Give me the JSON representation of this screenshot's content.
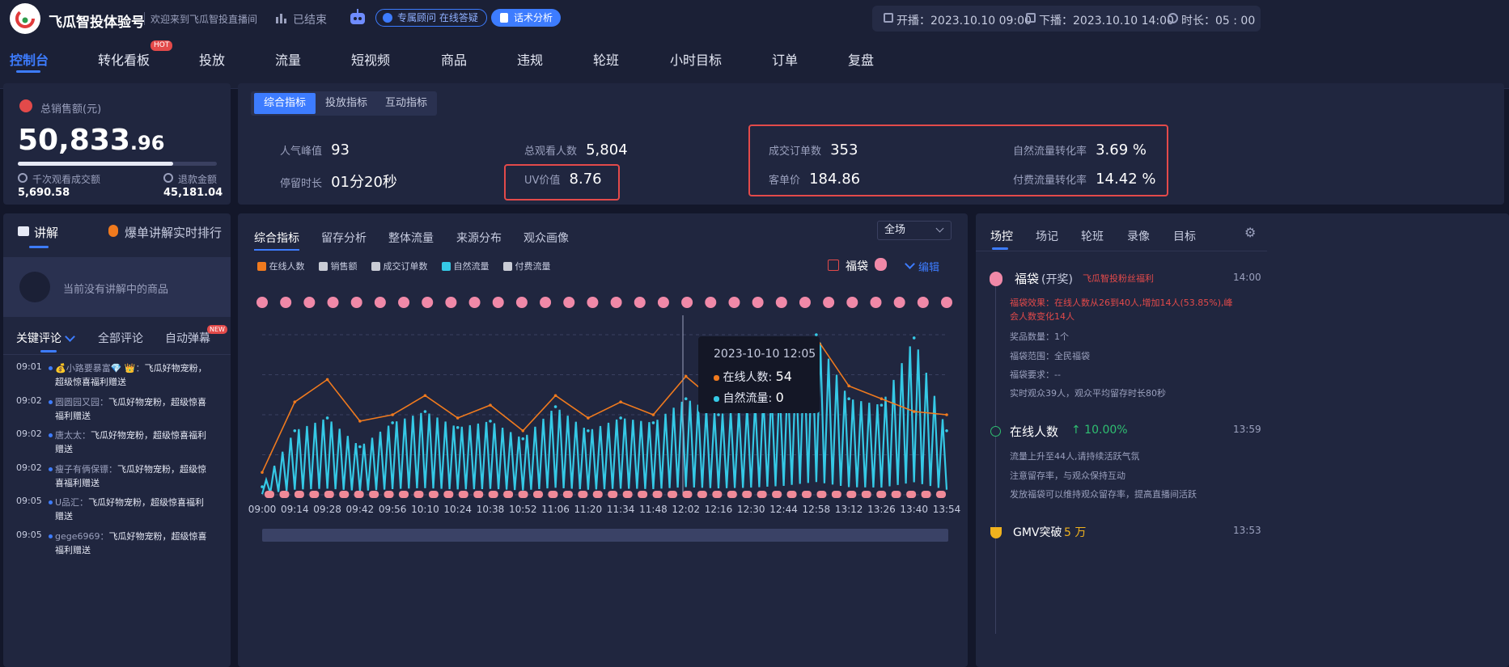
{
  "header": {
    "account_name": "飞瓜智投体验号",
    "welcome": "欢迎来到飞瓜智投直播间",
    "status": "已结束",
    "consultant": "专属顾问 在线答疑",
    "script_analysis": "话术分析",
    "start_label": "开播：",
    "start_time": "2023.10.10 09:00",
    "end_label": "下播：",
    "end_time": "2023.10.10 14:00",
    "duration_label": "时长：",
    "duration": "05 : 00"
  },
  "nav": {
    "items": [
      "控制台",
      "转化看板",
      "投放",
      "流量",
      "短视频",
      "商品",
      "违规",
      "轮班",
      "小时目标",
      "订单",
      "复盘"
    ],
    "hot_badge": "HOT"
  },
  "sales": {
    "title": "总销售额(元)",
    "amount_main": "50,833",
    "amount_dec": ".96",
    "progress": 0.78,
    "left_label": "千次观看成交额",
    "left_value": "5,690.58",
    "right_label": "退款金额",
    "right_value": "45,181.04"
  },
  "metrics": {
    "tabs": [
      "综合指标",
      "投放指标",
      "互动指标"
    ],
    "peak_label": "人气峰值",
    "peak": "93",
    "total_viewers_label": "总观看人数",
    "total_viewers": "5,804",
    "orders_label": "成交订单数",
    "orders": "353",
    "natural_conv_label": "自然流量转化率",
    "natural_conv": "3.69 %",
    "stay_label": "停留时长",
    "stay": "01分20秒",
    "uv_label": "UV价值",
    "uv": "8.76",
    "avg_price_label": "客单价",
    "avg_price": "184.86",
    "paid_conv_label": "付费流量转化率",
    "paid_conv": "14.42 %"
  },
  "explain": {
    "tab1": "讲解",
    "tab2": "爆单讲解实时排行",
    "empty": "当前没有讲解中的商品"
  },
  "comments": {
    "tabs": [
      "关键评论",
      "全部评论",
      "自动弹幕"
    ],
    "new_badge": "NEW",
    "items": [
      {
        "time": "09:01",
        "user": "💰小路要暴富💎 👑：",
        "line1": "飞瓜好物宠粉，",
        "line2": "超级惊喜福利赠送"
      },
      {
        "time": "09:02",
        "user": "圆圆园又园：",
        "line1": "飞瓜好物宠粉，超级惊喜",
        "line2": "福利赠送"
      },
      {
        "time": "09:02",
        "user": "唐太太：",
        "line1": "飞瓜好物宠粉，超级惊喜福利",
        "line2": "赠送"
      },
      {
        "time": "09:02",
        "user": "瘦子有俩保镖：",
        "line1": "飞瓜好物宠粉，超级惊",
        "line2": "喜福利赠送"
      },
      {
        "time": "09:05",
        "user": "U品汇：",
        "line1": "飞瓜好物宠粉，超级惊喜福利",
        "line2": "赠送"
      },
      {
        "time": "09:05",
        "user": "gege6969：",
        "line1": "飞瓜好物宠粉，超级惊喜",
        "line2": "福利赠送"
      }
    ]
  },
  "chart_tabs": [
    "综合指标",
    "留存分析",
    "整体流量",
    "来源分布",
    "观众画像"
  ],
  "scope_select": "全场",
  "legend": [
    "在线人数",
    "销售额",
    "成交订单数",
    "自然流量",
    "付费流量"
  ],
  "fudai_label": "福袋",
  "edit_label": "编辑",
  "tooltip": {
    "time": "2023-10-10 12:05",
    "online_label": "在线人数:",
    "online": "54",
    "natural_label": "自然流量:",
    "natural": "0"
  },
  "colors": {
    "online": "#f07a1e",
    "natural": "#35c9e6",
    "accent": "#3d7cff",
    "highlight": "#e34a4a"
  },
  "chart_data": {
    "type": "line",
    "x": [
      "09:00",
      "09:14",
      "09:28",
      "09:42",
      "09:56",
      "10:10",
      "10:24",
      "10:38",
      "10:52",
      "11:06",
      "11:20",
      "11:34",
      "11:48",
      "12:02",
      "12:16",
      "12:30",
      "12:44",
      "12:58",
      "13:12",
      "13:26",
      "13:40",
      "13:54"
    ],
    "series": [
      {
        "name": "在线人数",
        "values": [
          14,
          58,
          72,
          46,
          50,
          62,
          48,
          56,
          40,
          62,
          48,
          58,
          50,
          74,
          57,
          52,
          74,
          98,
          68,
          60,
          52,
          50
        ]
      },
      {
        "name": "自然流量",
        "values": [
          5,
          40,
          48,
          30,
          45,
          52,
          42,
          46,
          35,
          55,
          40,
          48,
          45,
          60,
          50,
          56,
          70,
          100,
          60,
          56,
          98,
          40
        ]
      }
    ],
    "ylim": [
      0,
      100
    ]
  },
  "right": {
    "tabs": [
      "场控",
      "场记",
      "轮班",
      "录像",
      "目标"
    ],
    "e1": {
      "title": "福袋",
      "sub": "(开奖)",
      "tag": "飞瓜智投粉丝福利",
      "time": "14:00",
      "red1": "福袋效果：在线人数从26到40人,增加14人(53.85%),峰",
      "red2": "会人数变化14人",
      "l1": "奖品数量：1个",
      "l2": "福袋范围：全民福袋",
      "l3": "福袋要求：--",
      "l4": "实时观众39人，观众平均留存时长80秒"
    },
    "e2": {
      "title": "在线人数",
      "change": "↑ 10.00%",
      "time": "13:59",
      "l1": "流量上升至44人,请持续活跃气氛",
      "l2": "注意留存率，与观众保持互动",
      "l3": "发放福袋可以维持观众留存率，提高直播间活跃"
    },
    "e3": {
      "title": "GMV突破",
      "value": "5 万",
      "time": "13:53"
    }
  }
}
